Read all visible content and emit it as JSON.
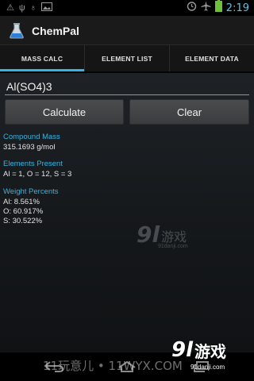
{
  "status_bar": {
    "time": "2:19",
    "icons": [
      "warning-icon",
      "usb-icon",
      "usb-debug-icon",
      "image-icon",
      "alarm-icon",
      "airplane-icon",
      "battery-icon"
    ]
  },
  "app": {
    "title": "ChemPal"
  },
  "tabs": [
    {
      "label": "MASS CALC",
      "active": true
    },
    {
      "label": "ELEMENT LIST",
      "active": false
    },
    {
      "label": "ELEMENT DATA",
      "active": false
    }
  ],
  "input": {
    "formula": "Al(SO4)3"
  },
  "buttons": {
    "calculate": "Calculate",
    "clear": "Clear"
  },
  "results": {
    "compound_mass_label": "Compound Mass",
    "compound_mass_value": "315.1693 g/mol",
    "elements_present_label": "Elements Present",
    "elements_present_value": "Al = 1, O = 12, S = 3",
    "weight_percents_label": "Weight Percents",
    "weight_percents": [
      "Al: 8.561%",
      "O: 60.917%",
      "S: 30.522%"
    ]
  },
  "watermark": {
    "center_91": "9l",
    "center_cn": "游戏",
    "center_sub": "91danji.com",
    "bottom_text": "11玩意儿 • 11WYX.COM",
    "logo_91": "9l",
    "logo_cn": "游戏",
    "logo_sub": "91danji.com"
  },
  "colors": {
    "accent": "#33b5e5",
    "time": "#5fc1e8"
  }
}
